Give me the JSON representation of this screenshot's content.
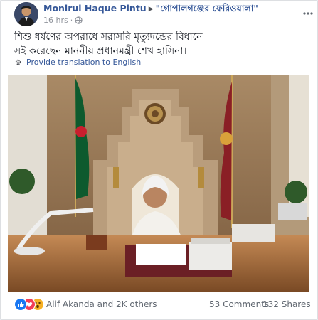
{
  "post": {
    "author": "Monirul Haque Pintu",
    "arrow": "▶",
    "group": "\"গোপালগঞ্জের ফেরিওয়ালা\"",
    "time": "16 hrs",
    "dot": "·",
    "text_line1": "শিশু ধর্ষণের অপরাধে সরাসরি মৃত্যুদন্ডের বিধানে",
    "text_line2": "সই করেছেন মাননীয় প্রধানমন্ত্রী শেখ হাসিনা।",
    "translate_label": "Provide translation to English"
  },
  "footer": {
    "reaction_names": "Alif Akanda and 2K others",
    "comments": "53 Comments",
    "shares": "132 Shares"
  },
  "icons": [
    "globe-icon",
    "gear-icon",
    "more-options-icon",
    "like-reaction-icon",
    "love-reaction-icon",
    "wow-reaction-icon"
  ],
  "colors": {
    "link": "#365899",
    "muted": "#90949c",
    "like": "#1877f2",
    "love": "#f33e58",
    "wow": "#f7b125"
  }
}
